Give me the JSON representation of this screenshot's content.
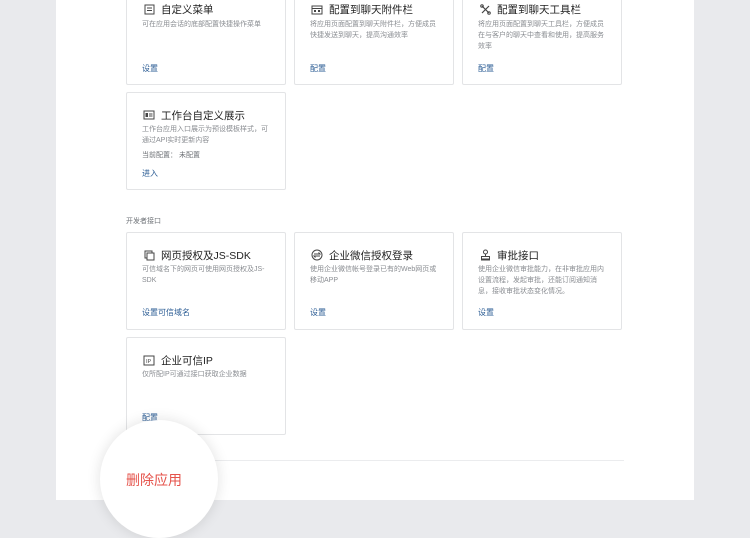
{
  "cards_top": [
    {
      "title": "自定义菜单",
      "icon": "menu-icon",
      "desc": "可在应用会话的底部配置快捷操作菜单",
      "link": "设置"
    },
    {
      "title": "配置到聊天附件栏",
      "icon": "attachment-bar-icon",
      "desc": "将应用页面配置到聊天附件栏，方便成员快捷发送到聊天，提高沟通效率",
      "link": "配置"
    },
    {
      "title": "配置到聊天工具栏",
      "icon": "toolbar-icon",
      "desc": "将应用页面配置到聊天工具栏，方便成员在与客户的聊天中查看和使用，提高服务效率",
      "link": "配置"
    }
  ],
  "workbench_card": {
    "title": "工作台自定义展示",
    "icon": "workbench-icon",
    "desc": "工作台应用入口展示为预设模板样式，可通过API实时更新内容",
    "meta": "当前配置： 未配置",
    "link": "进入"
  },
  "dev_section_label": "开发者接口",
  "cards_dev": [
    {
      "title": "网页授权及JS-SDK",
      "icon": "web-auth-icon",
      "desc": "可信域名下的网页可使用网页授权及JS-SDK",
      "link": "设置可信域名"
    },
    {
      "title": "企业微信授权登录",
      "icon": "login-auth-icon",
      "desc": "使用企业微信帐号登录已有的Web网页或移动APP",
      "link": "设置"
    },
    {
      "title": "审批接口",
      "icon": "approval-stamp-icon",
      "desc": "使用企业微信审批能力，在非审批应用内设置流程，发起审批，还能订阅通知消息，接收审批状态变化情况。",
      "link": "设置"
    }
  ],
  "trusted_ip_card": {
    "title": "企业可信IP",
    "icon": "ip-icon",
    "desc": "仅所配IP可通过接口获取企业数据",
    "link": "配置"
  },
  "delete_app_label": "删除应用",
  "colors": {
    "link": "#2b5c94",
    "danger": "#e5534b",
    "page_bg": "#e9eaed"
  }
}
